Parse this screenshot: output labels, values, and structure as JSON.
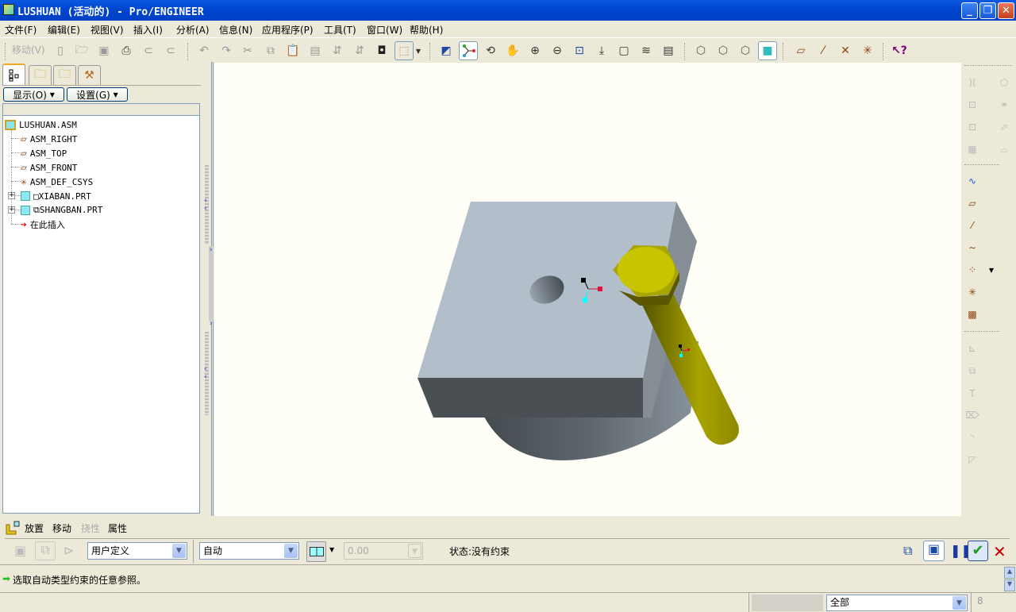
{
  "window": {
    "title": "LUSHUAN (活动的) - Pro/ENGINEER",
    "minimize": "_",
    "restore": "❐",
    "close": "✕"
  },
  "menu": [
    "文件(F)",
    "编辑(E)",
    "视图(V)",
    "插入(I)",
    "分析(A)",
    "信息(N)",
    "应用程序(P)",
    "工具(T)",
    "窗口(W)",
    "帮助(H)"
  ],
  "toolbar": {
    "move_label": "移动(V)",
    "icons": [
      "new-icon",
      "open-icon",
      "save-icon",
      "print-icon",
      "send-email-icon",
      "send-link-icon",
      "undo-icon",
      "redo-icon",
      "cut-icon",
      "copy-icon",
      "paste-icon",
      "paste-special-icon",
      "regenerate-icon",
      "regen-manager-icon",
      "find-icon",
      "select-box-icon",
      "repaint-icon",
      "spin-center-icon",
      "orient-mode-icon",
      "pan-icon",
      "zoom-in-icon",
      "zoom-out-icon",
      "refit-icon",
      "reorient-icon",
      "saved-views-icon",
      "layers-icon",
      "view-manager-icon",
      "wireframe-icon",
      "hidden-line-icon",
      "no-hidden-icon",
      "shading-icon",
      "datum-planes-toggle-icon",
      "datum-axes-toggle-icon",
      "datum-points-toggle-icon",
      "csys-toggle-icon",
      "context-help-icon"
    ]
  },
  "left_panel": {
    "tabs": [
      "model-tree-tab",
      "folder-browser-tab",
      "favorites-tab",
      "connections-tab"
    ],
    "show_button": "显示(O)",
    "settings_button": "设置(G)",
    "tree": [
      {
        "label": "LUSHUAN.ASM",
        "icon": "assembly-icon"
      },
      {
        "label": "ASM_RIGHT",
        "icon": "datum-plane-icon"
      },
      {
        "label": "ASM_TOP",
        "icon": "datum-plane-icon"
      },
      {
        "label": "ASM_FRONT",
        "icon": "datum-plane-icon"
      },
      {
        "label": "ASM_DEF_CSYS",
        "icon": "csys-icon"
      },
      {
        "label": "□XIABAN.PRT",
        "icon": "part-icon"
      },
      {
        "label": "⧉SHANGBAN.PRT",
        "icon": "part-icon"
      },
      {
        "label": "在此插入",
        "icon": "insert-here-arrow-icon"
      }
    ]
  },
  "dashboard": {
    "tabs": [
      {
        "label": "放置",
        "enabled": true
      },
      {
        "label": "移动",
        "enabled": true
      },
      {
        "label": "挠性",
        "enabled": false
      },
      {
        "label": "属性",
        "enabled": true
      }
    ],
    "constraint_set": "用户定义",
    "constraint_type": "自动",
    "offset_value": "0.00",
    "status": "状态:没有约束"
  },
  "message": "选取自动类型约束的任意参照。",
  "statusbar": {
    "filter": "全部"
  },
  "colors": {
    "title_blue": "#0047d0",
    "block": "#b2bec9",
    "bolt": "#c8c400",
    "confirm_green": "#1a9e1a",
    "cancel_red": "#c00000"
  }
}
